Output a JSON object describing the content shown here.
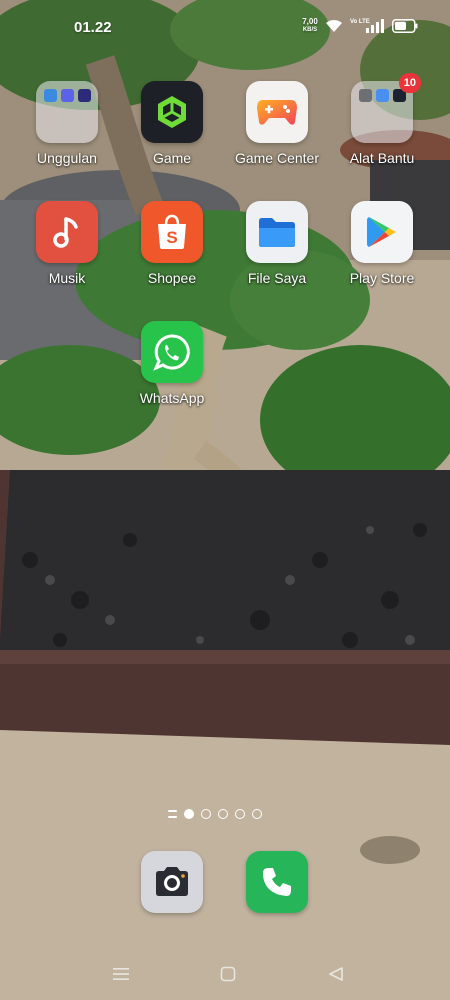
{
  "status_bar": {
    "time": "01.22",
    "net_speed": "7,00",
    "net_unit": "KB/S",
    "sim_label": "Vo LTE",
    "icons": [
      "wifi-icon",
      "signal-icon",
      "battery-icon"
    ]
  },
  "home_apps": [
    {
      "label": "Unggulan",
      "type": "folder",
      "icon": "folder-icon"
    },
    {
      "label": "Game",
      "type": "app",
      "icon": "game-icon"
    },
    {
      "label": "Game Center",
      "type": "app",
      "icon": "game-center-icon"
    },
    {
      "label": "Alat Bantu",
      "type": "folder",
      "icon": "folder-icon",
      "badge": "10"
    },
    {
      "label": "Musik",
      "type": "app",
      "icon": "music-icon"
    },
    {
      "label": "Shopee",
      "type": "app",
      "icon": "shopee-icon"
    },
    {
      "label": "File Saya",
      "type": "app",
      "icon": "files-icon"
    },
    {
      "label": "Play Store",
      "type": "app",
      "icon": "play-store-icon"
    },
    {
      "label": "WhatsApp",
      "type": "app",
      "icon": "whatsapp-icon"
    }
  ],
  "page_indicator": {
    "pages": 5,
    "active": 1
  },
  "dock": [
    {
      "icon": "camera-icon"
    },
    {
      "icon": "phone-icon"
    }
  ],
  "nav_bar": [
    "menu-icon",
    "home-icon",
    "back-icon"
  ],
  "colors": {
    "music": "#e2503f",
    "shopee": "#f0582b",
    "whatsapp": "#27c34a",
    "phone": "#27b55a",
    "camera": "#d5d7dc",
    "game": "#1d2127",
    "badge": "#e8343a"
  }
}
